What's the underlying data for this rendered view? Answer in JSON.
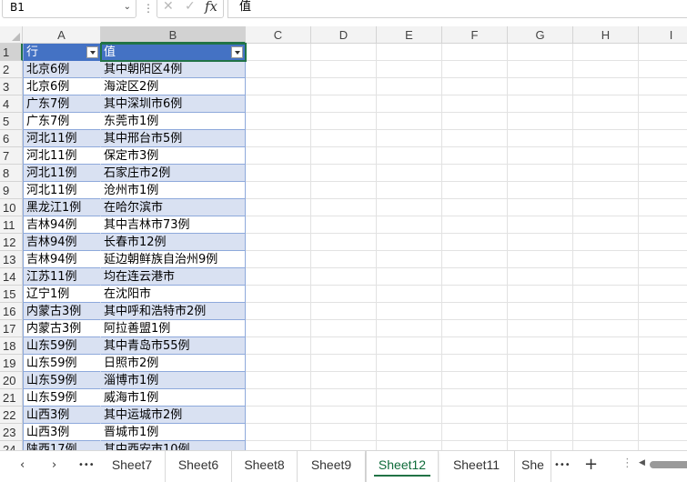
{
  "formula_bar": {
    "name_box": "B1",
    "fx_label": "fx",
    "formula": "值"
  },
  "columns": [
    "A",
    "B",
    "C",
    "D",
    "E",
    "F",
    "G",
    "H",
    "I"
  ],
  "table": {
    "headers": [
      "行",
      "值"
    ],
    "rows": [
      [
        "北京6例",
        "其中朝阳区4例"
      ],
      [
        "北京6例",
        "海淀区2例"
      ],
      [
        "广东7例",
        "其中深圳市6例"
      ],
      [
        "广东7例",
        "东莞市1例"
      ],
      [
        "河北11例",
        "其中邢台市5例"
      ],
      [
        "河北11例",
        "保定市3例"
      ],
      [
        "河北11例",
        "石家庄市2例"
      ],
      [
        "河北11例",
        "沧州市1例"
      ],
      [
        "黑龙江1例",
        "在哈尔滨市"
      ],
      [
        "吉林94例",
        "其中吉林市73例"
      ],
      [
        "吉林94例",
        "长春市12例"
      ],
      [
        "吉林94例",
        "延边朝鲜族自治州9例"
      ],
      [
        "江苏11例",
        "均在连云港市"
      ],
      [
        "辽宁1例",
        "在沈阳市"
      ],
      [
        "内蒙古3例",
        "其中呼和浩特市2例"
      ],
      [
        "内蒙古3例",
        "阿拉善盟1例"
      ],
      [
        "山东59例",
        "其中青岛市55例"
      ],
      [
        "山东59例",
        "日照市2例"
      ],
      [
        "山东59例",
        "淄博市1例"
      ],
      [
        "山东59例",
        "威海市1例"
      ],
      [
        "山西3例",
        "其中运城市2例"
      ],
      [
        "山西3例",
        "晋城市1例"
      ],
      [
        "陕西17例",
        "其中西安市10例"
      ]
    ]
  },
  "sheet_tabs": {
    "tabs": [
      "Sheet7",
      "Sheet6",
      "Sheet8",
      "Sheet9",
      "Sheet12",
      "Sheet11",
      "She"
    ],
    "active": "Sheet12",
    "nav_prev": "‹",
    "nav_next": "›",
    "more": "•••",
    "add": "+",
    "menu": "⋮"
  },
  "colors": {
    "table_header": "#4472c4",
    "band_row": "#d9e1f2",
    "accent": "#217346"
  }
}
